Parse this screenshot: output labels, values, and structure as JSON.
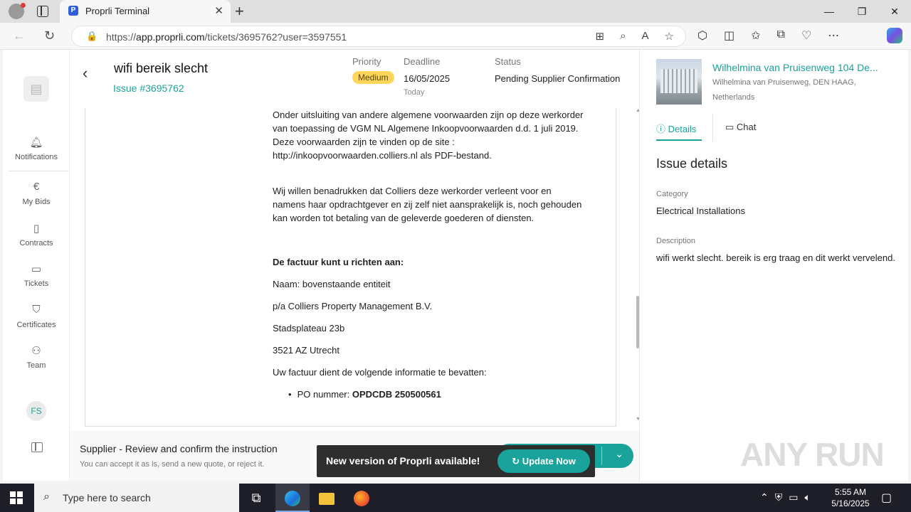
{
  "browser": {
    "tab_title": "Proprli Terminal",
    "url_prefix": "https://",
    "url_host": "app.proprli.com",
    "url_path": "/tickets/3695762?user=3597551"
  },
  "nav": {
    "items": [
      {
        "label": "Notifications"
      },
      {
        "label": "My Bids"
      },
      {
        "label": "Contracts"
      },
      {
        "label": "Tickets"
      },
      {
        "label": "Certificates"
      },
      {
        "label": "Team"
      }
    ],
    "avatar_initials": "FS"
  },
  "ticket": {
    "title": "wifi bereik slecht",
    "issue_number": "Issue #3695762",
    "priority_label": "Priority",
    "priority_value": "Medium",
    "deadline_label": "Deadline",
    "deadline_value": "16/05/2025",
    "deadline_sub": "Today",
    "status_label": "Status",
    "status_value": "Pending Supplier Confirmation"
  },
  "document": {
    "para1": "Onder uitsluiting van andere algemene voorwaarden zijn op deze werkorder van toepassing de VGM NL Algemene Inkoopvoorwaarden d.d. 1 juli 2019. Deze voorwaarden zijn te vinden op de site : http://inkoopvoorwaarden.colliers.nl als PDF-bestand.",
    "para2": "Wij willen benadrukken dat Colliers deze werkorder verleent voor en namens haar opdrachtgever en zij zelf niet aansprakelijk is, noch gehouden kan worden tot betaling van de geleverde goederen of diensten.",
    "invoice_heading": "De factuur kunt u richten aan:",
    "line_name": "Naam: bovenstaande entiteit",
    "line_pa": "p/a Colliers Property Management B.V.",
    "line_street": "Stadsplateau 23b",
    "line_city": "3521 AZ Utrecht",
    "line_info": "Uw factuur dient de volgende informatie te bevatten:",
    "po_label": "PO nummer: ",
    "po_value": "OPDCDB 250500561"
  },
  "footer": {
    "title": "Supplier - Review and confirm the instruction",
    "subtitle": "You can accept it as is, send a new quote, or reject it."
  },
  "toast": {
    "message": "New version of Proprli available!",
    "button": "Update Now"
  },
  "property": {
    "name": "Wilhelmina van Pruisenweg 104 De...",
    "address": "Wilhelmina van Pruisenweg, DEN HAAG,",
    "country": "Netherlands"
  },
  "right_tabs": {
    "details": "Details",
    "chat": "Chat"
  },
  "issue_details": {
    "heading": "Issue details",
    "category_label": "Category",
    "category_value": "Electrical Installations",
    "description_label": "Description",
    "description_value": "wifi werkt slecht. bereik is erg traag en dit werkt vervelend."
  },
  "taskbar": {
    "search_placeholder": "Type here to search",
    "time": "5:55 AM",
    "date": "5/16/2025"
  },
  "watermark": "ANY RUN",
  "colors": {
    "accent": "#1aa39a",
    "priority_badge": "#ffd65a"
  }
}
